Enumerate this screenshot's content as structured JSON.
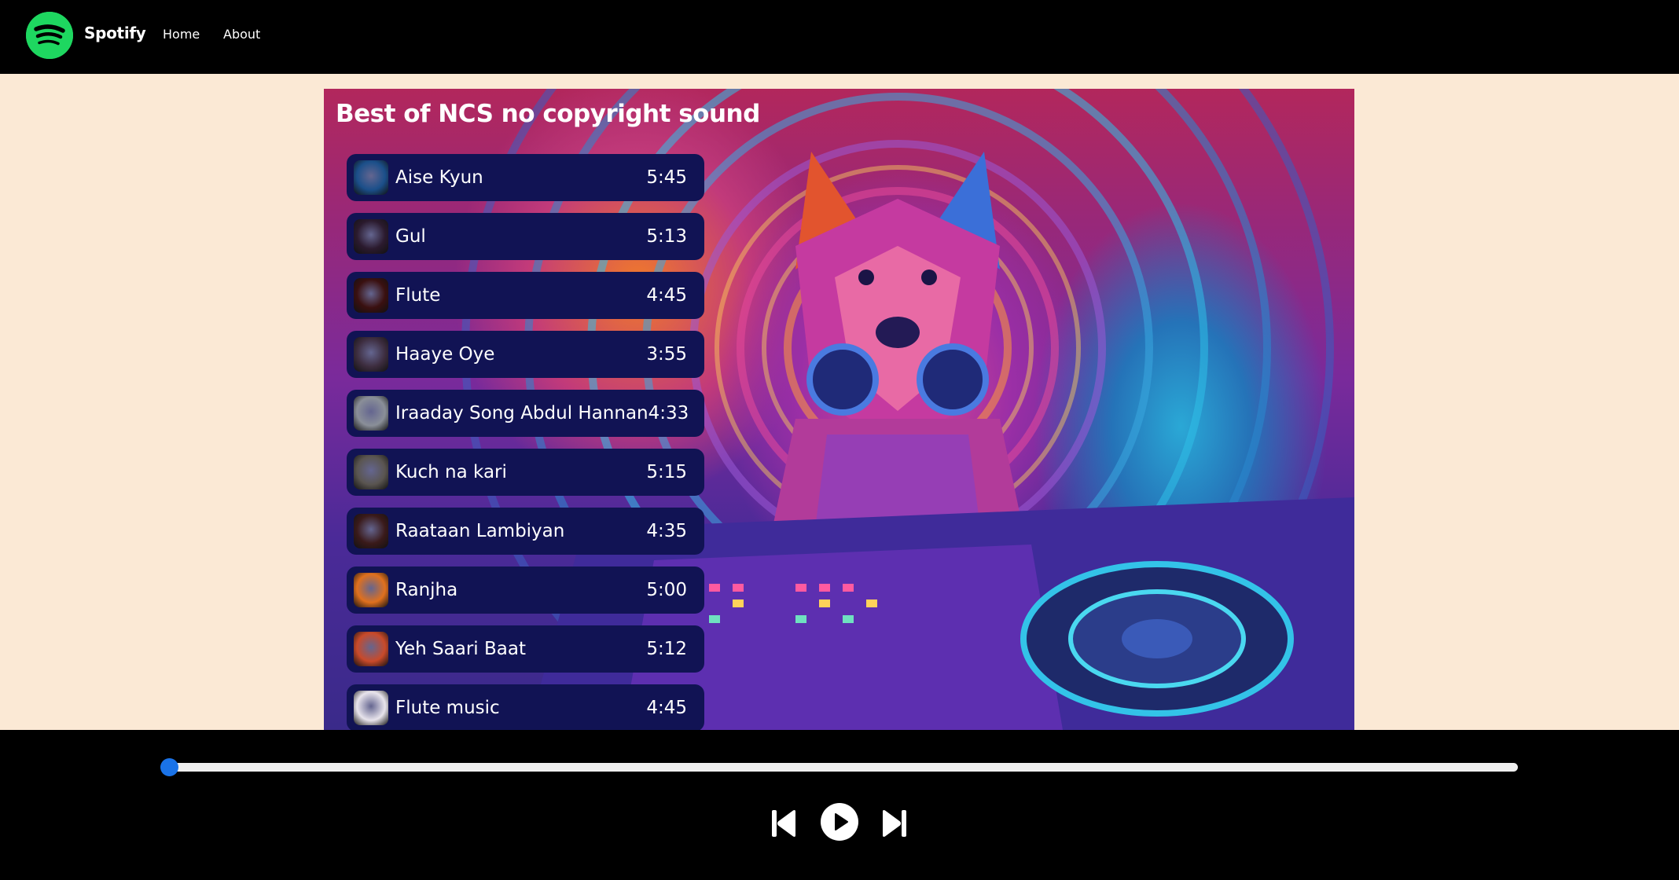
{
  "navbar": {
    "logo_icon": "spotify-logo-icon",
    "brand": "Spotify",
    "links": {
      "home": "Home",
      "about": "About"
    }
  },
  "playlist": {
    "title": "Best of NCS no copyright sound",
    "songs": [
      {
        "name": "Aise Kyun",
        "duration": "5:45",
        "thumb_color": "#1b4f8a"
      },
      {
        "name": "Gul",
        "duration": "5:13",
        "thumb_color": "#2b1a2e"
      },
      {
        "name": "Flute",
        "duration": "4:45",
        "thumb_color": "#3a1010"
      },
      {
        "name": "Haaye Oye",
        "duration": "3:55",
        "thumb_color": "#3d2d3f"
      },
      {
        "name": "Iraaday Song Abdul Hannan",
        "duration": "4:33",
        "thumb_color": "#8a8f98"
      },
      {
        "name": "Kuch na kari",
        "duration": "5:15",
        "thumb_color": "#5a5550"
      },
      {
        "name": "Raataan Lambiyan",
        "duration": "4:35",
        "thumb_color": "#3a1a1a"
      },
      {
        "name": "Ranjha",
        "duration": "5:00",
        "thumb_color": "#e0701e"
      },
      {
        "name": "Yeh Saari Baat",
        "duration": "5:12",
        "thumb_color": "#c94a2a"
      },
      {
        "name": "Flute music",
        "duration": "4:45",
        "thumb_color": "#e8e4ec"
      }
    ]
  },
  "player": {
    "progress_fraction": 0.0,
    "controls": {
      "previous_icon": "skip-previous-icon",
      "play_icon": "play-circle-icon",
      "next_icon": "skip-next-icon"
    }
  },
  "colors": {
    "navbar_bg": "#000000",
    "page_bg": "#fbe9d5",
    "song_item_bg": "#111354",
    "progress_accent": "#1a73e8",
    "spotify_green": "#1ed760"
  }
}
